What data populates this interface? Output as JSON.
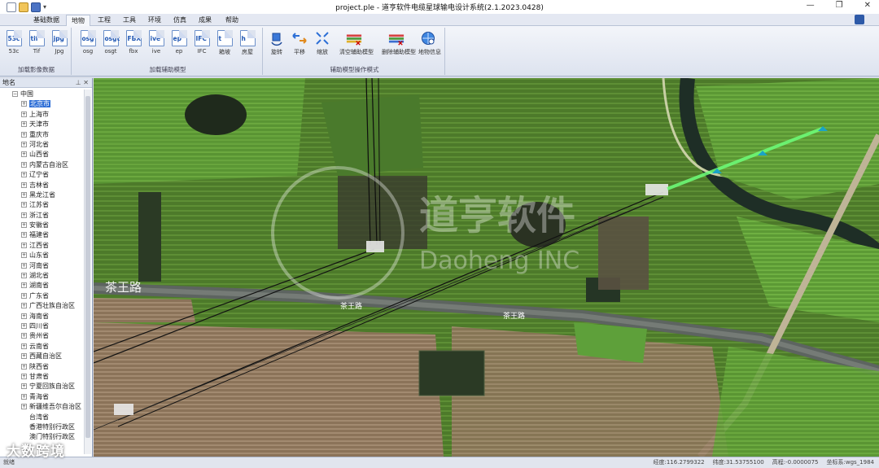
{
  "window": {
    "title": "project.ple - 道亨软件电缆星球输电设计系统(2.1.2023.0428)",
    "controls": [
      "—",
      "❐",
      "✕"
    ]
  },
  "menu": {
    "tabs": [
      "基础数据",
      "地物",
      "工程",
      "工具",
      "环境",
      "仿真",
      "成果",
      "帮助"
    ],
    "active": "地物"
  },
  "ribbon": {
    "groups": [
      {
        "name": "加载影像数据",
        "buttons": [
          "53c",
          "Tif",
          "Jpg"
        ],
        "icon_labels": [
          "53c",
          "tif",
          "jpg"
        ]
      },
      {
        "name": "加载辅助模型",
        "buttons": [
          "osg",
          "osgt",
          "fbx",
          "ive",
          "ep",
          "IFC",
          "箱坡",
          "房屋"
        ],
        "icon_labels": [
          "osg",
          "osgt",
          "FBX",
          "ive",
          "ep",
          "IFC",
          "t",
          "h"
        ]
      },
      {
        "name": "辅助模型操作模式",
        "buttons": [
          "旋转",
          "平移",
          "缩放",
          "清空辅助模型",
          "删除辅助模型",
          "地物信息"
        ]
      }
    ]
  },
  "left_panel": {
    "title": "地名",
    "root": "中国",
    "items": [
      "北京市",
      "上海市",
      "天津市",
      "重庆市",
      "河北省",
      "山西省",
      "内蒙古自治区",
      "辽宁省",
      "吉林省",
      "黑龙江省",
      "江苏省",
      "浙江省",
      "安徽省",
      "福建省",
      "江西省",
      "山东省",
      "河南省",
      "湖北省",
      "湖南省",
      "广东省",
      "广西壮族自治区",
      "海南省",
      "四川省",
      "贵州省",
      "云南省",
      "西藏自治区",
      "陕西省",
      "甘肃省",
      "宁夏回族自治区",
      "青海省",
      "新疆维吾尔自治区",
      "台湾省",
      "香港特别行政区",
      "澳门特别行政区"
    ],
    "selected": "北京市"
  },
  "map": {
    "watermark_cn": "道亨软件",
    "watermark_en": "Daoheng INC",
    "road_labels": [
      "茶王路",
      "茶王路",
      "茶王路"
    ]
  },
  "status": {
    "left": "就绪",
    "fields": [
      "经度:116.2799322",
      "纬度:31.53755100",
      "高程:-0.0000075",
      "坐标系:wgs_1984"
    ]
  },
  "overlay": {
    "text": "大数跨境"
  }
}
